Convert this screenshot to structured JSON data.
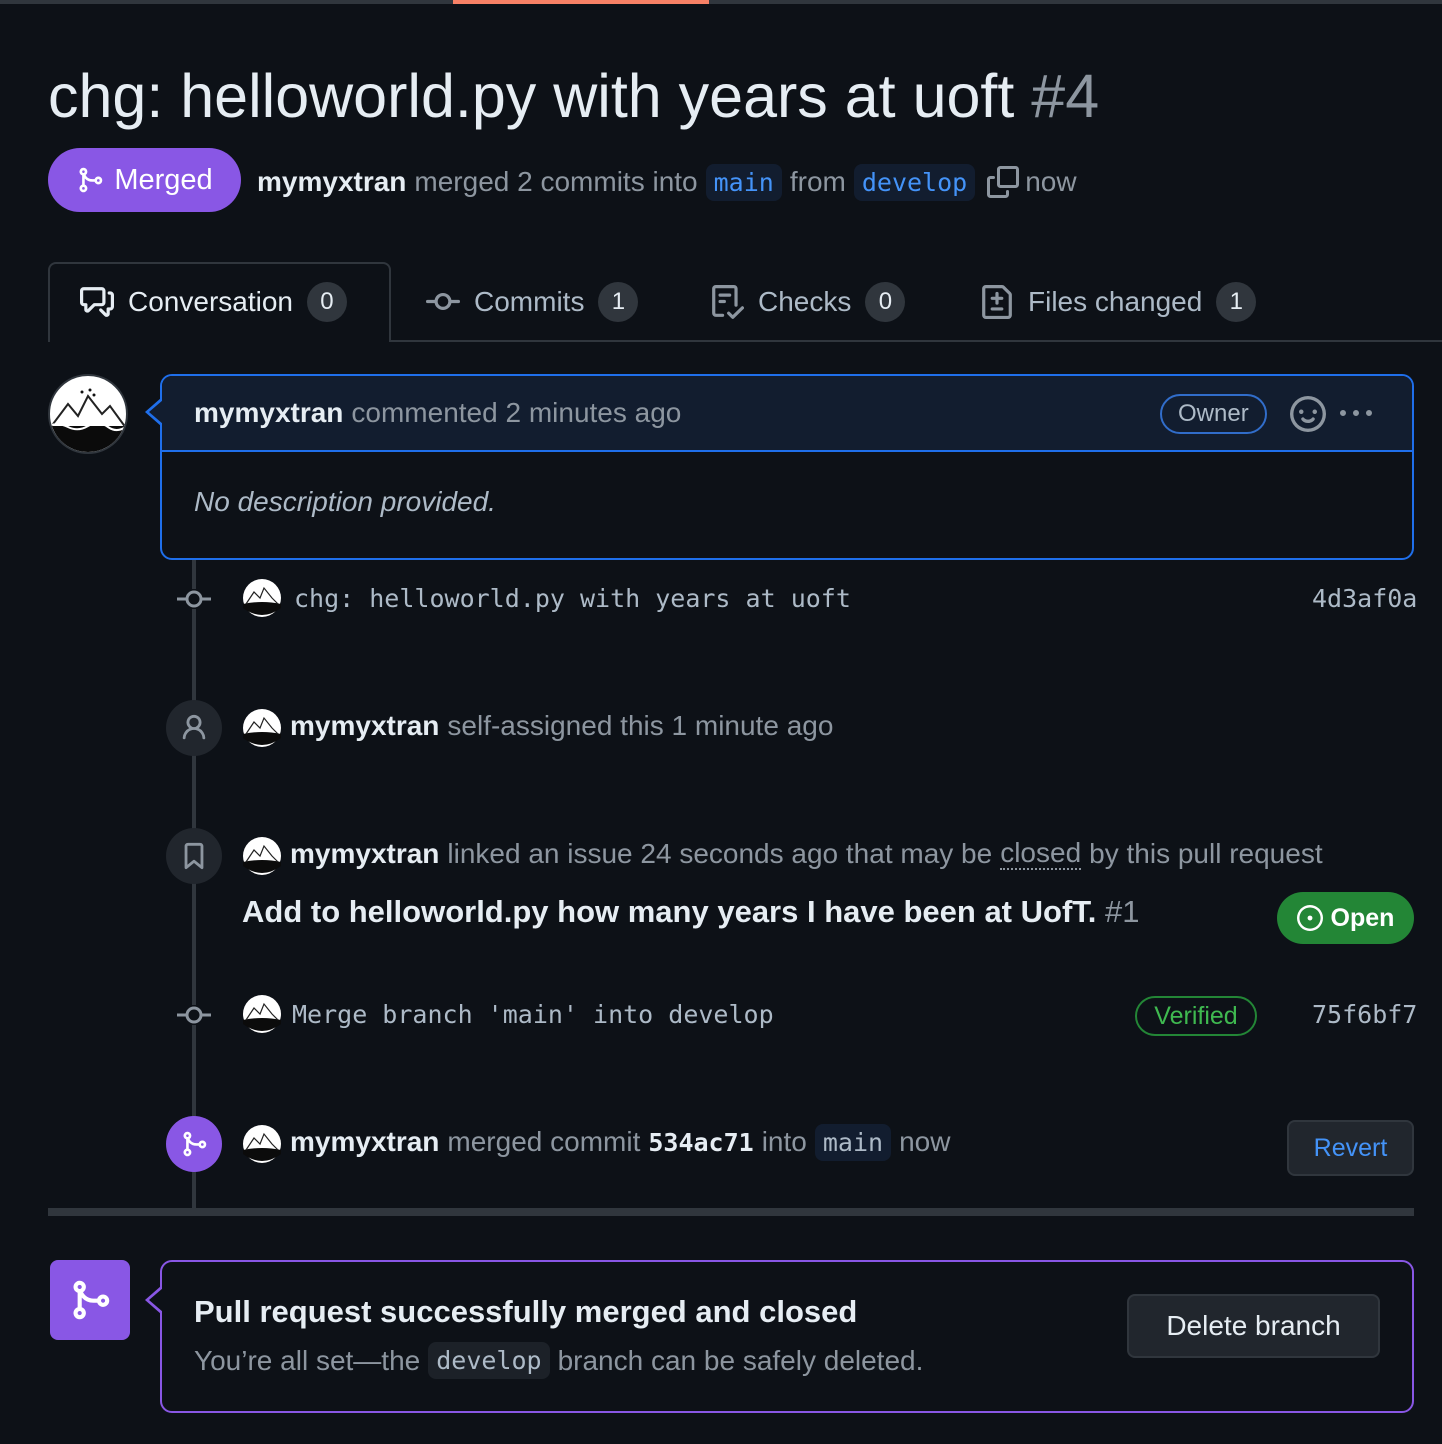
{
  "pr": {
    "title": "chg: helloworld.py with years at uoft",
    "number": "#4",
    "state": "Merged",
    "author": "mymyxtran",
    "merge_text": "merged 2 commits into",
    "base_branch": "main",
    "from_text": "from",
    "head_branch": "develop",
    "time": "now"
  },
  "tabs": [
    {
      "label": "Conversation",
      "count": "0",
      "icon": "comment-discussion-icon"
    },
    {
      "label": "Commits",
      "count": "1",
      "icon": "git-commit-icon"
    },
    {
      "label": "Checks",
      "count": "0",
      "icon": "checklist-icon"
    },
    {
      "label": "Files changed",
      "count": "1",
      "icon": "file-diff-icon"
    }
  ],
  "comment": {
    "author": "mymyxtran",
    "action": "commented 2 minutes ago",
    "badge": "Owner",
    "body": "No description provided."
  },
  "timeline": {
    "commit1": {
      "message": "chg: helloworld.py with years at uoft",
      "sha": "4d3af0a"
    },
    "assign": {
      "author": "mymyxtran",
      "text": "self-assigned this 1 minute ago"
    },
    "link": {
      "author": "mymyxtran",
      "text_before": "linked an issue 24 seconds ago that may be",
      "closed": "closed",
      "text_after": "by this pull request",
      "issue_title": "Add to helloworld.py how many years I have been at UofT.",
      "issue_number": "#1",
      "issue_state": "Open"
    },
    "commit2": {
      "message": "Merge branch 'main' into develop",
      "verified": "Verified",
      "sha": "75f6bf7"
    },
    "merged": {
      "author": "mymyxtran",
      "text": "merged commit",
      "sha": "534ac71",
      "into": "into",
      "branch": "main",
      "time": "now",
      "revert_label": "Revert"
    }
  },
  "merge_box": {
    "title": "Pull request successfully merged and closed",
    "sub_before": "You’re all set—the",
    "branch": "develop",
    "sub_after": "branch can be safely deleted.",
    "button": "Delete branch"
  },
  "colors": {
    "background": "#0d1117",
    "merged_purple": "#8957e5",
    "open_green": "#238636",
    "link_blue": "#4493f8",
    "accent_underline": "#f78166"
  }
}
